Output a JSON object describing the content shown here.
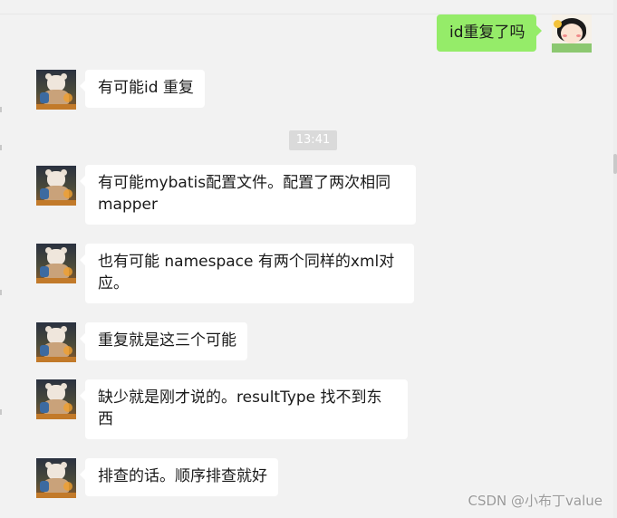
{
  "messages": [
    {
      "side": "self",
      "text": "id重复了吗"
    },
    {
      "side": "other",
      "text": "有可能id 重复"
    },
    {
      "side": "other",
      "text": "有可能mybatis配置文件。配置了两次相同\nmapper"
    },
    {
      "side": "other",
      "text": "也有可能 namespace 有两个同样的xml对\n应。"
    },
    {
      "side": "other",
      "text": "重复就是这三个可能"
    },
    {
      "side": "other",
      "text": "缺少就是刚才说的。resultType 找不到东\n西"
    },
    {
      "side": "other",
      "text": "排查的话。顺序排查就好"
    }
  ],
  "timestamp": "13:41",
  "watermark": "CSDN @小布丁value",
  "colors": {
    "background": "#f2f2f2",
    "self_bubble": "#95ec69",
    "other_bubble": "#ffffff",
    "timestamp_bg": "#dadada"
  },
  "icons": {
    "self_avatar": "cartoon-girl-avatar-icon",
    "other_avatar": "teddy-bear-photo-avatar-icon"
  }
}
